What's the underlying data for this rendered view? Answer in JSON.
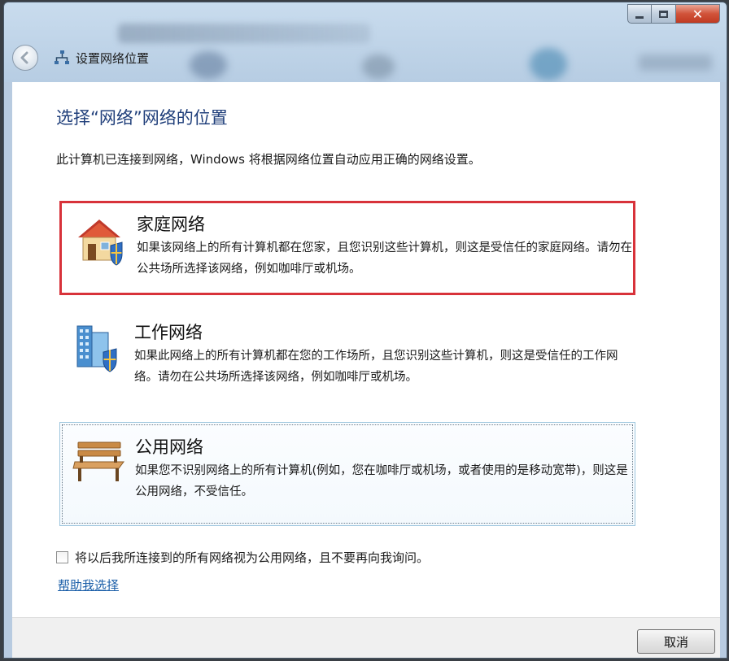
{
  "window": {
    "nav_title": "设置网络位置",
    "caption": {
      "close_label": "✕"
    }
  },
  "main": {
    "heading": "选择“网络”网络的位置",
    "description": "此计算机已连接到网络，Windows 将根据网络位置自动应用正确的网络设置。",
    "options": [
      {
        "title": "家庭网络",
        "description": "如果该网络上的所有计算机都在您家，且您识别这些计算机，则这是受信任的家庭网络。请勿在公共场所选择该网络，例如咖啡厅或机场。",
        "icon": "house-shield-icon",
        "highlighted": true
      },
      {
        "title": "工作网络",
        "description": "如果此网络上的所有计算机都在您的工作场所，且您识别这些计算机，则这是受信任的工作网络。请勿在公共场所选择该网络，例如咖啡厅或机场。",
        "icon": "office-building-shield-icon"
      },
      {
        "title": "公用网络",
        "description": "如果您不识别网络上的所有计算机(例如，您在咖啡厅或机场，或者使用的是移动宽带)，则这是公用网络，不受信任。",
        "icon": "park-bench-icon",
        "focused": true
      }
    ],
    "checkbox": {
      "label": "将以后我所连接到的所有网络视为公用网络，且不要再向我询问。",
      "checked": false
    },
    "help_link": "帮助我选择"
  },
  "footer": {
    "cancel_label": "取消"
  },
  "colors": {
    "heading": "#1f3e7a",
    "highlight_border": "#d8323a",
    "link": "#1a5ea8"
  }
}
